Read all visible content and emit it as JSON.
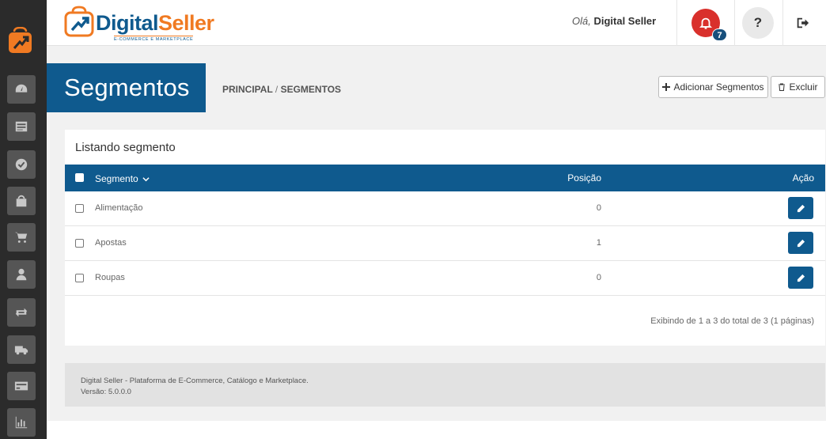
{
  "brand": {
    "name_part1": "Digital",
    "name_part2": "Seller",
    "tagline": "E-COMMERCE E MARKETPLACE"
  },
  "header": {
    "greeting": "Olá,",
    "user_name": "Digital Seller",
    "notification_count": "7",
    "help_label": "?"
  },
  "sidebar": {
    "items": [
      {
        "name": "dashboard-icon"
      },
      {
        "name": "catalog-icon"
      },
      {
        "name": "check-icon"
      },
      {
        "name": "shopping-bag-icon"
      },
      {
        "name": "cart-icon"
      },
      {
        "name": "user-icon"
      },
      {
        "name": "exchange-icon"
      },
      {
        "name": "truck-icon"
      },
      {
        "name": "credit-card-icon"
      },
      {
        "name": "bar-chart-icon"
      }
    ]
  },
  "page": {
    "title": "Segmentos",
    "breadcrumb": {
      "home": "PRINCIPAL",
      "separator": "/",
      "current": "SEGMENTOS"
    },
    "add_button": "Adicionar Segmentos",
    "delete_button": "Excluir"
  },
  "table": {
    "title": "Listando segmento",
    "columns": {
      "segment": "Segmento",
      "position": "Posição",
      "action": "Ação"
    },
    "rows": [
      {
        "segment": "Alimentação",
        "position": "0"
      },
      {
        "segment": "Apostas",
        "position": "1"
      },
      {
        "segment": "Roupas",
        "position": "0"
      }
    ],
    "pager_text": "Exibindo de 1 a 3 do total de 3 (1 páginas)"
  },
  "footer": {
    "line1": "Digital Seller - Plataforma de E-Commerce, Catálogo e Marketplace.",
    "line2": "Versão: 5.0.0.0"
  },
  "colors": {
    "primary": "#0f5a8e",
    "accent": "#f07a22",
    "alert": "#d9302c",
    "sidebar": "#2b2b2b"
  }
}
